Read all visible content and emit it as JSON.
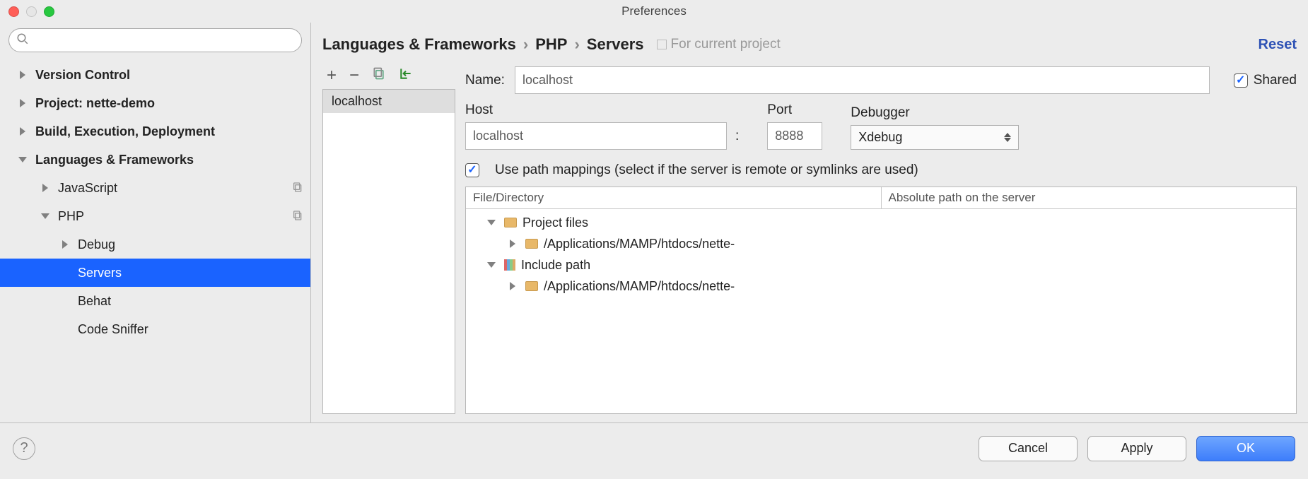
{
  "window": {
    "title": "Preferences"
  },
  "sidebar": {
    "items": [
      {
        "label": "Version Control"
      },
      {
        "label": "Project: nette-demo"
      },
      {
        "label": "Build, Execution, Deployment"
      },
      {
        "label": "Languages & Frameworks"
      },
      {
        "label": "JavaScript"
      },
      {
        "label": "PHP"
      },
      {
        "label": "Debug"
      },
      {
        "label": "Servers"
      },
      {
        "label": "Behat"
      },
      {
        "label": "Code Sniffer"
      }
    ]
  },
  "breadcrumb": {
    "c1": "Languages & Frameworks",
    "c2": "PHP",
    "c3": "Servers",
    "scope": "For current project",
    "reset": "Reset"
  },
  "serverList": {
    "items": [
      "localhost"
    ]
  },
  "form": {
    "nameLabel": "Name:",
    "name": "localhost",
    "sharedLabel": "Shared",
    "hostLabel": "Host",
    "host": "localhost",
    "portLabel": "Port",
    "port": "8888",
    "colon": ":",
    "debuggerLabel": "Debugger",
    "debugger": "Xdebug",
    "usePathLabel": "Use path mappings (select if the server is remote or symlinks are used)"
  },
  "grid": {
    "col1": "File/Directory",
    "col2": "Absolute path on the server",
    "rows": {
      "projectFiles": "Project files",
      "path1": "/Applications/MAMP/htdocs/nette-",
      "includePath": "Include path",
      "path2": "/Applications/MAMP/htdocs/nette-"
    }
  },
  "footer": {
    "cancel": "Cancel",
    "apply": "Apply",
    "ok": "OK"
  }
}
